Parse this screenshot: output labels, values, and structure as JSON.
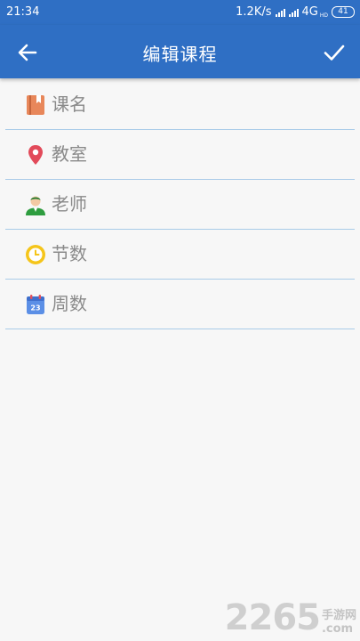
{
  "status_bar": {
    "time": "21:34",
    "network_speed": "1.2K/s",
    "network_type": "4G",
    "battery": "41"
  },
  "app_bar": {
    "title": "编辑课程",
    "back_icon": "arrow-left-icon",
    "done_icon": "check-icon",
    "background": "#2f6fc4"
  },
  "fields": [
    {
      "placeholder": "课名",
      "value": "",
      "icon": "book-icon"
    },
    {
      "placeholder": "教室",
      "value": "",
      "icon": "location-pin-icon"
    },
    {
      "placeholder": "老师",
      "value": "",
      "icon": "teacher-icon"
    },
    {
      "placeholder": "节数",
      "value": "",
      "icon": "clock-icon"
    },
    {
      "placeholder": "周数",
      "value": "",
      "icon": "calendar-icon"
    }
  ],
  "calendar_icon_day": "23",
  "watermark": {
    "number": "2265",
    "site_cn": "手游网",
    "domain": ".com"
  }
}
